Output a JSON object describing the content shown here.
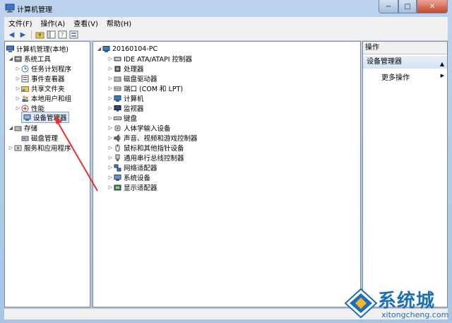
{
  "window": {
    "title": "计算机管理",
    "minimize": "−",
    "maximize": "□",
    "close": "✕"
  },
  "menu": [
    "文件(F)",
    "操作(A)",
    "查看(V)",
    "帮助(H)"
  ],
  "toolbar": {
    "back": "◀",
    "forward": "▶"
  },
  "left_tree": {
    "root": "计算机管理(本地)",
    "system_tools": "系统工具",
    "items": [
      "任务计划程序",
      "事件查看器",
      "共享文件夹",
      "本地用户和组",
      "性能",
      "设备管理器"
    ],
    "storage": "存储",
    "disk_mgmt": "磁盘管理",
    "services": "服务和应用程序"
  },
  "device_tree": {
    "computer": "20160104-PC",
    "devices": [
      {
        "label": "IDE ATA/ATAPI 控制器",
        "icon": "ide-controller-icon"
      },
      {
        "label": "处理器",
        "icon": "processor-icon"
      },
      {
        "label": "磁盘驱动器",
        "icon": "disk-drive-icon"
      },
      {
        "label": "端口 (COM 和 LPT)",
        "icon": "port-icon"
      },
      {
        "label": "计算机",
        "icon": "computer-icon"
      },
      {
        "label": "监视器",
        "icon": "monitor-icon"
      },
      {
        "label": "键盘",
        "icon": "keyboard-icon"
      },
      {
        "label": "人体学输入设备",
        "icon": "hid-icon"
      },
      {
        "label": "声音、视频和游戏控制器",
        "icon": "sound-icon"
      },
      {
        "label": "鼠标和其他指针设备",
        "icon": "mouse-icon"
      },
      {
        "label": "通用串行总线控制器",
        "icon": "usb-icon"
      },
      {
        "label": "网络适配器",
        "icon": "network-adapter-icon"
      },
      {
        "label": "系统设备",
        "icon": "system-device-icon"
      },
      {
        "label": "显示适配器",
        "icon": "display-adapter-icon"
      }
    ]
  },
  "actions": {
    "header": "操作",
    "section": "设备管理器",
    "more": "更多操作",
    "arrow": "▲",
    "more_arrow": "▶"
  },
  "watermark": {
    "brand": "系统城",
    "url": "xitongcheng.com"
  },
  "colors": {
    "annotation_arrow": "#e8322a",
    "selection": "#dfe9f5",
    "accent": "#1b6fb8"
  }
}
